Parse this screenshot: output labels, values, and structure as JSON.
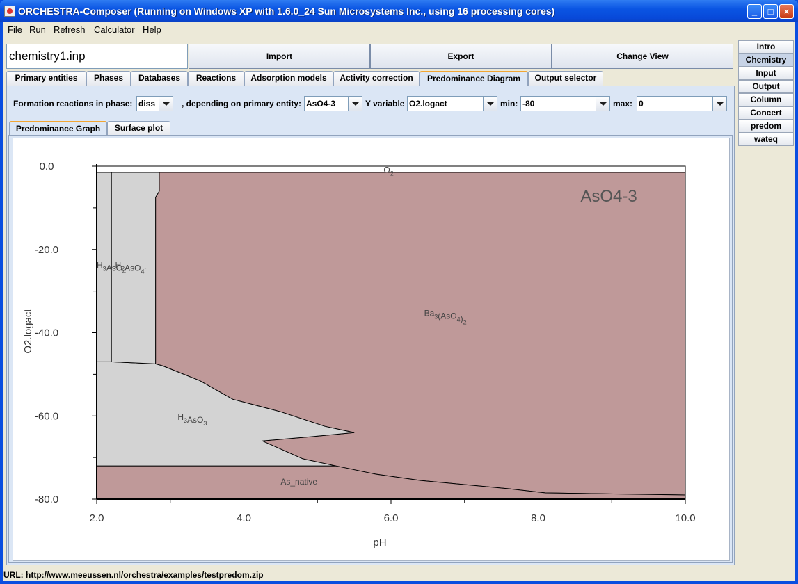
{
  "window": {
    "title": "ORCHESTRA-Composer (Running on Windows XP with 1.6.0_24  Sun Microsystems Inc., using 16 processing cores)"
  },
  "menu": [
    "File",
    "Run",
    "Refresh",
    "Calculator",
    "Help"
  ],
  "header": {
    "filename": "chemistry1.inp",
    "buttons": [
      "Import",
      "Export",
      "Change View"
    ]
  },
  "sidebar": [
    "Intro",
    "Chemistry",
    "Input",
    "Output",
    "Column",
    "Concert",
    "predom",
    "wateq"
  ],
  "sidebar_active": "Chemistry",
  "tabs": [
    "Primary entities",
    "Phases",
    "Databases",
    "Reactions",
    "Adsorption models",
    "Activity correction",
    "Predominance Diagram",
    "Output selector"
  ],
  "active_tab": "Predominance Diagram",
  "controls": {
    "phase_label": "Formation reactions in phase:",
    "phase_value": "diss",
    "entity_label": ", depending on primary entity:",
    "entity_value": "AsO4-3",
    "yvar_label": "Y variable",
    "yvar_value": "O2.logact",
    "min_label": "min:",
    "min_value": "-80",
    "max_label": "max:",
    "max_value": "0"
  },
  "subtabs": [
    "Predominance Graph",
    "Surface plot"
  ],
  "active_subtab": "Predominance Graph",
  "chart_data": {
    "type": "area",
    "title": "AsO4-3",
    "xlabel": "pH",
    "ylabel": "O2.logact",
    "xlim": [
      2.0,
      10.0
    ],
    "ylim": [
      -80.0,
      0.0
    ],
    "xticks": [
      "2.0",
      "4.0",
      "6.0",
      "8.0",
      "10.0"
    ],
    "yticks": [
      "0.0",
      "-20.0",
      "-40.0",
      "-60.0",
      "-80.0"
    ],
    "regions": [
      {
        "name": "O2",
        "color": "#ffffff",
        "polygon": [
          [
            2.0,
            -1.5
          ],
          [
            10.0,
            -1.5
          ],
          [
            10.0,
            0.0
          ],
          [
            2.0,
            0.0
          ]
        ]
      },
      {
        "name": "Ba3(AsO4)2",
        "color": "#bf9999",
        "polygon": [
          [
            2.8,
            -1.5
          ],
          [
            10.0,
            -1.5
          ],
          [
            10.0,
            -79.0
          ],
          [
            8.1,
            -78.5
          ],
          [
            7.6,
            -77.5
          ],
          [
            6.4,
            -75.5
          ],
          [
            5.8,
            -74.0
          ],
          [
            5.25,
            -72.5
          ],
          [
            4.8,
            -70.3
          ],
          [
            4.25,
            -66.0
          ],
          [
            4.9,
            -65.0
          ],
          [
            5.5,
            -64.0
          ],
          [
            5.1,
            -62.5
          ],
          [
            4.5,
            -59.0
          ],
          [
            3.85,
            -56.0
          ],
          [
            3.4,
            -51.5
          ],
          [
            2.9,
            -48.0
          ],
          [
            2.8,
            -47.5
          ],
          [
            2.8,
            -7.5
          ],
          [
            2.85,
            -6.0
          ],
          [
            2.85,
            -1.5
          ]
        ]
      },
      {
        "name": "As_native",
        "color": "#bf9999",
        "polygon": [
          [
            2.0,
            -72.0
          ],
          [
            5.25,
            -72.0
          ],
          [
            5.8,
            -74.0
          ],
          [
            6.4,
            -75.5
          ],
          [
            7.6,
            -77.5
          ],
          [
            8.1,
            -78.5
          ],
          [
            10.0,
            -79.0
          ],
          [
            10.0,
            -80.0
          ],
          [
            2.0,
            -80.0
          ]
        ]
      },
      {
        "name": "H3AsO3",
        "color": "#d3d3d3",
        "polygon": [
          [
            2.0,
            -47.0
          ],
          [
            2.2,
            -47.0
          ],
          [
            2.8,
            -47.5
          ],
          [
            2.9,
            -48.0
          ],
          [
            3.4,
            -51.5
          ],
          [
            3.85,
            -56.0
          ],
          [
            4.5,
            -59.0
          ],
          [
            5.1,
            -62.5
          ],
          [
            5.5,
            -64.0
          ],
          [
            4.9,
            -65.0
          ],
          [
            4.25,
            -66.0
          ],
          [
            4.8,
            -70.3
          ],
          [
            5.25,
            -72.0
          ],
          [
            2.0,
            -72.0
          ]
        ]
      },
      {
        "name": "H3AsO4",
        "color": "#d3d3d3",
        "polygon": [
          [
            2.0,
            -1.5
          ],
          [
            2.2,
            -1.5
          ],
          [
            2.2,
            -47.0
          ],
          [
            2.0,
            -47.0
          ]
        ]
      },
      {
        "name": "H2AsO4-",
        "color": "#d3d3d3",
        "polygon": [
          [
            2.2,
            -1.5
          ],
          [
            2.85,
            -1.5
          ],
          [
            2.85,
            -6.0
          ],
          [
            2.8,
            -7.5
          ],
          [
            2.8,
            -47.5
          ],
          [
            2.2,
            -47.0
          ]
        ]
      }
    ],
    "labels": [
      {
        "text": "O2",
        "base": "O",
        "sub": "2",
        "x": 5.9,
        "y": -1.6
      },
      {
        "text": "H3AsO4",
        "base": "H",
        "sub": "3",
        "rest": "AsO4",
        "x": 2.0,
        "y": -24.5
      },
      {
        "text": "H2AsO4-",
        "x": 2.25,
        "y": -24.5
      },
      {
        "text": "Ba3(AsO4)2",
        "x": 6.45,
        "y": -36.0
      },
      {
        "text": "H3AsO3",
        "x": 3.1,
        "y": -61.0
      },
      {
        "text": "As_native",
        "x": 4.5,
        "y": -76.5
      }
    ]
  },
  "status": "URL: http://www.meeussen.nl/orchestra/examples/testpredom.zip"
}
